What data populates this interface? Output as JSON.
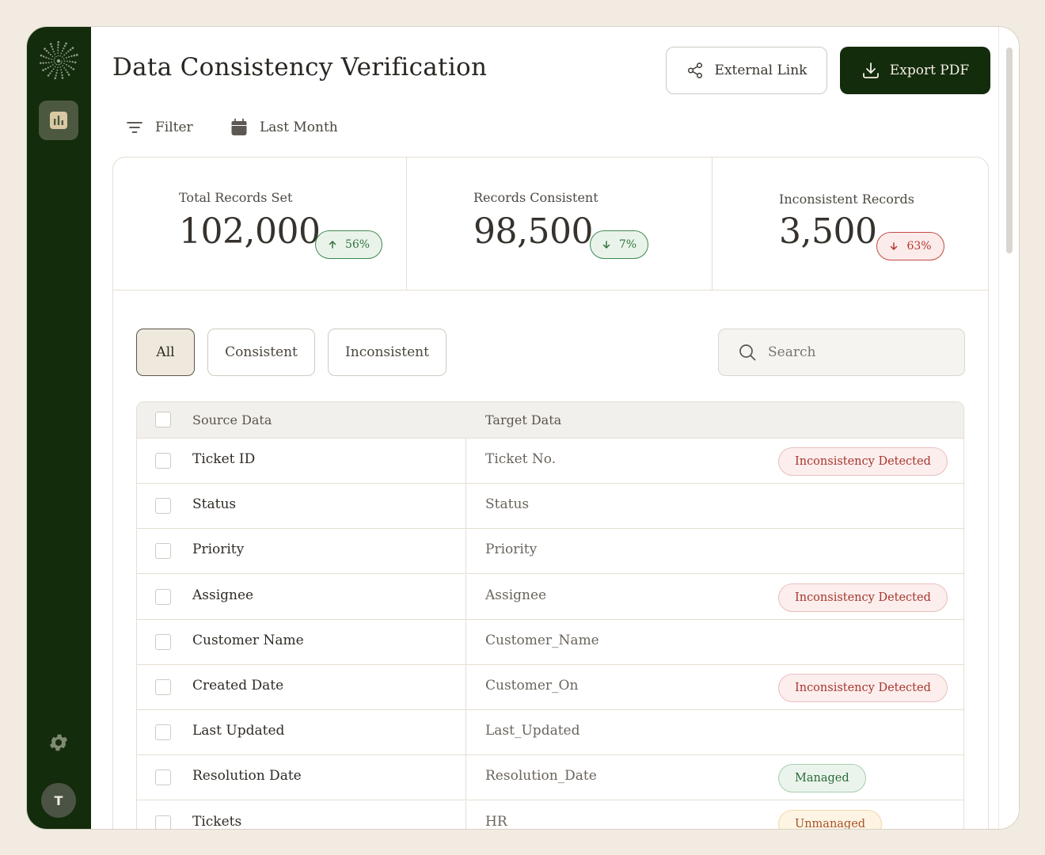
{
  "page": {
    "title": "Data Consistency Verification"
  },
  "header": {
    "external_link_label": "External Link",
    "export_label": "Export PDF"
  },
  "toolbar": {
    "filter_label": "Filter",
    "date_range_label": "Last Month"
  },
  "stats": [
    {
      "label": "Total Records Set",
      "value": "102,000",
      "change": "56%",
      "direction": "up",
      "tone": "green"
    },
    {
      "label": "Records Consistent",
      "value": "98,500",
      "change": "7%",
      "direction": "down",
      "tone": "green"
    },
    {
      "label": "Inconsistent Records",
      "value": "3,500",
      "change": "63%",
      "direction": "down",
      "tone": "red"
    }
  ],
  "segments": [
    {
      "label": "All",
      "active": true
    },
    {
      "label": "Consistent",
      "active": false
    },
    {
      "label": "Inconsistent",
      "active": false
    }
  ],
  "search": {
    "placeholder": "Search"
  },
  "table": {
    "columns": [
      "Source Data",
      "Target Data"
    ],
    "rows": [
      {
        "source": "Ticket ID",
        "target": "Ticket No.",
        "badge": "Inconsistency Detected",
        "badge_tone": "red"
      },
      {
        "source": "Status",
        "target": "Status",
        "badge": "",
        "badge_tone": ""
      },
      {
        "source": "Priority",
        "target": "Priority",
        "badge": "",
        "badge_tone": ""
      },
      {
        "source": "Assignee",
        "target": "Assignee",
        "badge": "Inconsistency Detected",
        "badge_tone": "red"
      },
      {
        "source": "Customer Name",
        "target": "Customer_Name",
        "badge": "",
        "badge_tone": ""
      },
      {
        "source": "Created Date",
        "target": "Customer_On",
        "badge": "Inconsistency Detected",
        "badge_tone": "red"
      },
      {
        "source": "Last Updated",
        "target": "Last_Updated",
        "badge": "",
        "badge_tone": ""
      },
      {
        "source": "Resolution Date",
        "target": "Resolution_Date",
        "badge": "Managed",
        "badge_tone": "green"
      },
      {
        "source": "Tickets",
        "target": "HR",
        "badge": "Unmanaged",
        "badge_tone": "amber"
      }
    ]
  },
  "user": {
    "avatar_initial": "T"
  },
  "colors": {
    "sidebar": "#132c0c",
    "accent_dark": "#132c0c",
    "badge_red": "#a8352c",
    "badge_green": "#2b6b3a",
    "badge_amber": "#a8522a"
  }
}
